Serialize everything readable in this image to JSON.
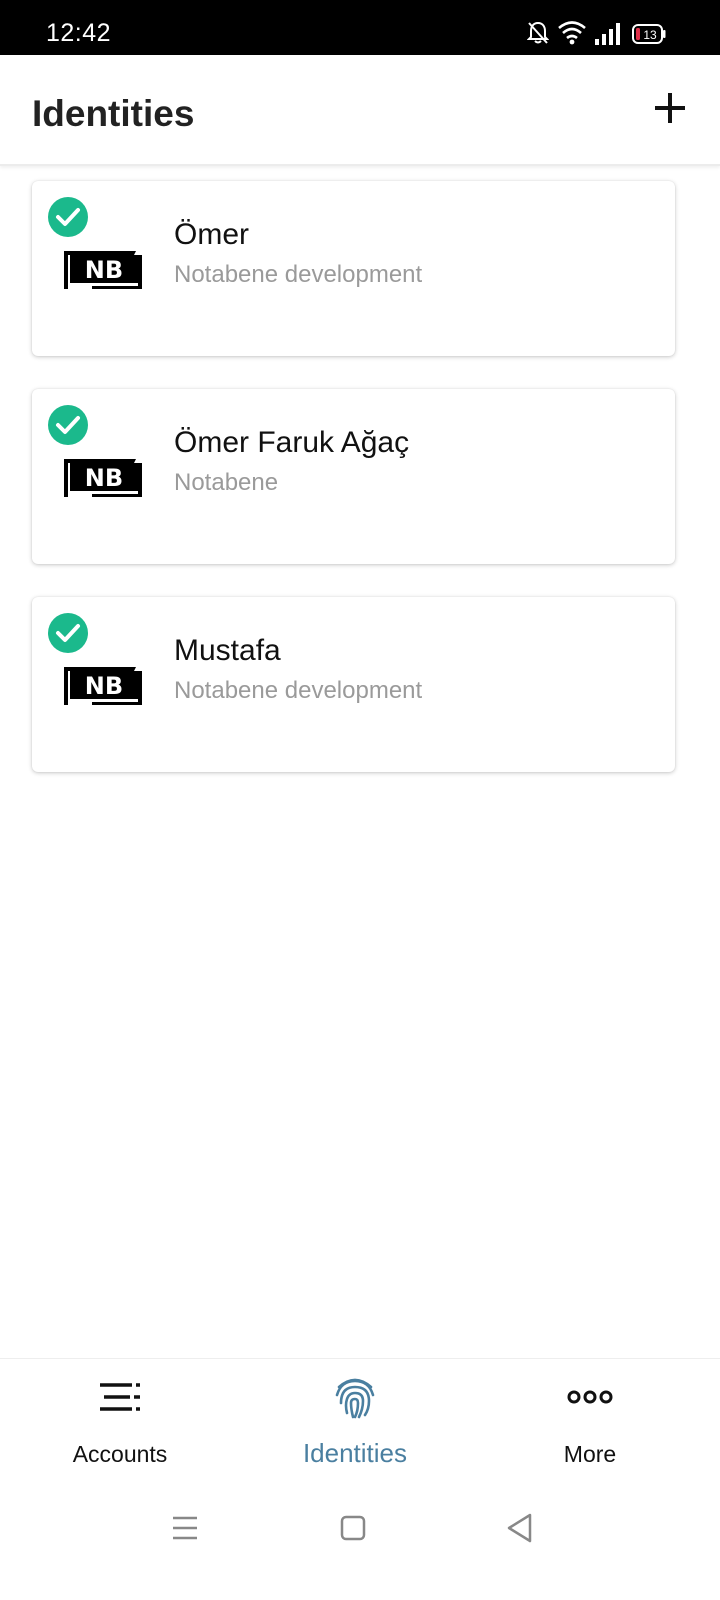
{
  "status_bar": {
    "time": "12:42",
    "battery_level": "13",
    "icons": [
      "bell-off-icon",
      "wifi-icon",
      "signal-icon",
      "battery-icon"
    ]
  },
  "app_bar": {
    "title": "Identities",
    "add_icon": "plus-icon"
  },
  "identities": [
    {
      "name": "Ömer",
      "organization": "Notabene development",
      "verified": true,
      "logo_text": "NB"
    },
    {
      "name": "Ömer Faruk Ağaç",
      "organization": "Notabene",
      "verified": true,
      "logo_text": "NB"
    },
    {
      "name": "Mustafa",
      "organization": "Notabene development",
      "verified": true,
      "logo_text": "NB"
    }
  ],
  "bottom_nav": {
    "items": [
      {
        "label": "Accounts",
        "icon": "list-icon",
        "active": false
      },
      {
        "label": "Identities",
        "icon": "fingerprint-icon",
        "active": true
      },
      {
        "label": "More",
        "icon": "more-dots-icon",
        "active": false
      }
    ]
  },
  "colors": {
    "check_green": "#1bb98c",
    "active_nav": "#4a7fa0",
    "subtitle_grey": "#9a9a9a"
  }
}
